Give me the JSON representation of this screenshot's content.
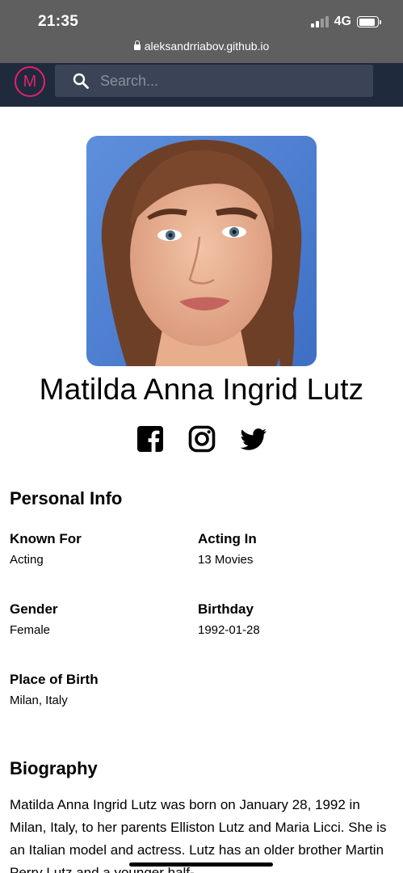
{
  "status_bar": {
    "time": "21:35",
    "network": "4G"
  },
  "browser": {
    "url": "aleksandrriabov.github.io"
  },
  "app_header": {
    "logo_letter": "M",
    "search_placeholder": "Search..."
  },
  "profile": {
    "name": "Matilda Anna Ingrid Lutz",
    "socials": [
      "facebook-icon",
      "instagram-icon",
      "twitter-icon"
    ]
  },
  "personal_info": {
    "title": "Personal Info",
    "fields": [
      {
        "label": "Known For",
        "value": "Acting"
      },
      {
        "label": "Acting In",
        "value": "13 Movies"
      },
      {
        "label": "Gender",
        "value": "Female"
      },
      {
        "label": "Birthday",
        "value": "1992-01-28"
      },
      {
        "label": "Place of Birth",
        "value": "Milan, Italy"
      }
    ]
  },
  "biography": {
    "title": "Biography",
    "text": "Matilda Anna Ingrid Lutz was born on January 28, 1992 in Milan, Italy, to her parents Elliston Lutz and Maria Licci. She is an Italian model and actress. Lutz has an older brother Martin Perry Lutz and a younger half-"
  },
  "colors": {
    "header_bg": "#1f2a3c",
    "logo_accent": "#e2226b",
    "search_bg": "#3b4456",
    "chrome_bg": "#5f5f5f"
  }
}
